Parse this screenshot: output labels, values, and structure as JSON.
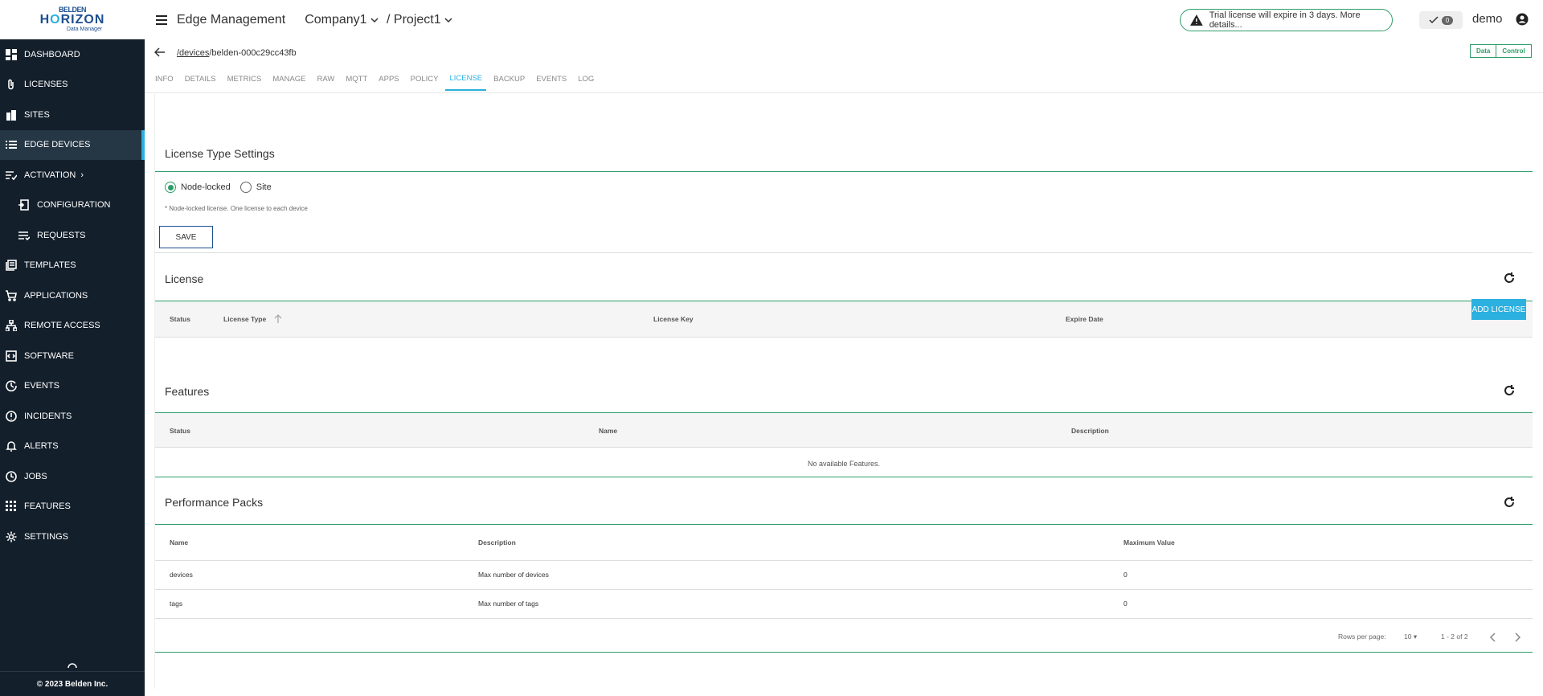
{
  "logo": {
    "top": "BELDEN",
    "main_a": "H",
    "main_o": "O",
    "main_b": "RIZON",
    "sub": "Data Manager"
  },
  "sidebar": {
    "items": [
      {
        "label": "DASHBOARD",
        "icon": "dashboard-icon"
      },
      {
        "label": "LICENSES",
        "icon": "paperclip-icon"
      },
      {
        "label": "SITES",
        "icon": "building-icon"
      },
      {
        "label": "EDGE DEVICES",
        "icon": "list-icon",
        "active": true
      },
      {
        "label": "ACTIVATION",
        "icon": "activation-icon"
      },
      {
        "label": "CONFIGURATION",
        "icon": "config-icon"
      },
      {
        "label": "REQUESTS",
        "icon": "requests-icon"
      },
      {
        "label": "TEMPLATES",
        "icon": "templates-icon"
      },
      {
        "label": "APPLICATIONS",
        "icon": "cart-icon"
      },
      {
        "label": "REMOTE ACCESS",
        "icon": "network-icon"
      },
      {
        "label": "SOFTWARE",
        "icon": "software-icon"
      },
      {
        "label": "EVENTS",
        "icon": "events-icon"
      },
      {
        "label": "INCIDENTS",
        "icon": "alert-circle-icon"
      },
      {
        "label": "ALERTS",
        "icon": "bell-icon"
      },
      {
        "label": "JOBS",
        "icon": "clock-icon"
      },
      {
        "label": "FEATURES",
        "icon": "grid-icon"
      },
      {
        "label": "SETTINGS",
        "icon": "gear-icon"
      }
    ],
    "footer": "© 2023 Belden Inc."
  },
  "topbar": {
    "title": "Edge Management",
    "company": "Company1",
    "separator": " / ",
    "project": "Project1",
    "trial_text": "Trial license will expire in 3 days. More details...",
    "notif_count": "0",
    "user": "demo"
  },
  "breadcrumb": {
    "link": "/devices",
    "device": "/belden-000c29cc43fb"
  },
  "toggle": {
    "data": "Data",
    "control": "Control"
  },
  "tabs": [
    "INFO",
    "DETAILS",
    "METRICS",
    "MANAGE",
    "RAW",
    "MQTT",
    "APPS",
    "POLICY",
    "LICENSE",
    "BACKUP",
    "EVENTS",
    "LOG"
  ],
  "active_tab": "LICENSE",
  "license_type": {
    "title": "License Type Settings",
    "option1": "Node-locked",
    "option2": "Site",
    "selected": "Node-locked",
    "hint": "* Node-locked license. One license to each device",
    "save": "SAVE"
  },
  "license": {
    "title": "License",
    "headers": {
      "status": "Status",
      "type": "License Type",
      "key": "License Key",
      "expire": "Expire Date"
    },
    "add": "ADD LICENSE"
  },
  "features": {
    "title": "Features",
    "headers": {
      "status": "Status",
      "name": "Name",
      "description": "Description"
    },
    "empty": "No available Features."
  },
  "packs": {
    "title": "Performance Packs",
    "headers": {
      "name": "Name",
      "description": "Description",
      "max": "Maximum Value"
    },
    "rows": [
      {
        "name": "devices",
        "description": "Max number of devices",
        "max": "0"
      },
      {
        "name": "tags",
        "description": "Max number of tags",
        "max": "0"
      }
    ],
    "rows_per_page_label": "Rows per page:",
    "rows_per_page": "10",
    "range": "1 - 2 of 2"
  }
}
